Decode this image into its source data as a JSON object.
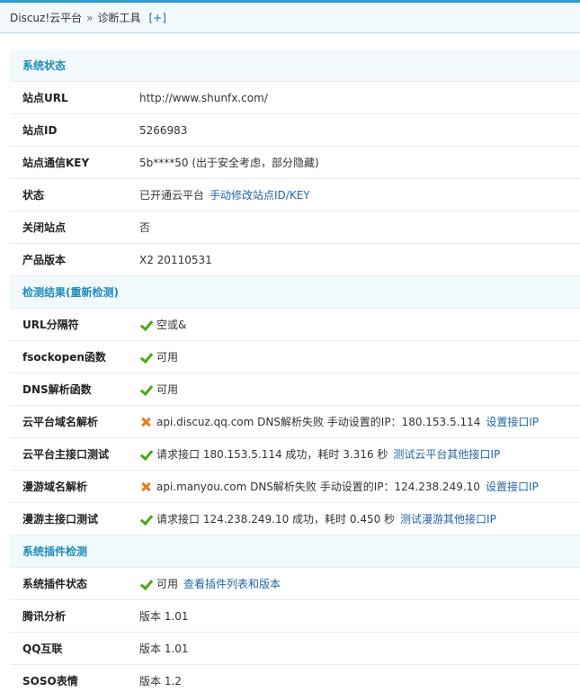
{
  "breadcrumb": {
    "root": "Discuz!云平台",
    "sep": "»",
    "current": "诊断工具",
    "add": "[+]"
  },
  "sections": [
    {
      "title": "系统状态",
      "rows": [
        {
          "label": "站点URL",
          "text": "http://www.shunfx.com/"
        },
        {
          "label": "站点ID",
          "text": "5266983"
        },
        {
          "label": "站点通信KEY",
          "text": "5b****50 (出于安全考虑，部分隐藏)"
        },
        {
          "label": "状态",
          "text": "已开通云平台",
          "link": "手动修改站点ID/KEY"
        },
        {
          "label": "关闭站点",
          "text": "否"
        },
        {
          "label": "产品版本",
          "text": "X2 20110531"
        }
      ]
    },
    {
      "title": "检测结果(重新检测)",
      "rows": [
        {
          "label": "URL分隔符",
          "icon": "ok",
          "text": "空或&"
        },
        {
          "label": "fsockopen函数",
          "icon": "ok",
          "text": "可用"
        },
        {
          "label": "DNS解析函数",
          "icon": "ok",
          "text": "可用"
        },
        {
          "label": "云平台域名解析",
          "icon": "fail",
          "text": "api.discuz.qq.com DNS解析失败 手动设置的IP：180.153.5.114",
          "link": "设置接口IP"
        },
        {
          "label": "云平台主接口测试",
          "icon": "ok",
          "text": "请求接口 180.153.5.114 成功，耗时 3.316 秒",
          "link": "测试云平台其他接口IP"
        },
        {
          "label": "漫游域名解析",
          "icon": "fail",
          "text": "api.manyou.com DNS解析失败 手动设置的IP：124.238.249.10",
          "link": "设置接口IP"
        },
        {
          "label": "漫游主接口测试",
          "icon": "ok",
          "text": "请求接口 124.238.249.10 成功，耗时 0.450 秒",
          "link": "测试漫游其他接口IP"
        }
      ]
    },
    {
      "title": "系统插件检测",
      "rows": [
        {
          "label": "系统插件状态",
          "icon": "ok",
          "text": "可用",
          "link": "查看插件列表和版本"
        },
        {
          "label": "腾讯分析",
          "text": "版本 1.01"
        },
        {
          "label": "QQ互联",
          "text": "版本 1.01"
        },
        {
          "label": "SOSO表情",
          "text": "版本 1.2"
        }
      ]
    }
  ],
  "colors": {
    "accent": "#1e8bb8",
    "link": "#2366a8",
    "ok": "#48a818",
    "fail": "#ee7b16",
    "section_bg": "#f2f9fd"
  }
}
